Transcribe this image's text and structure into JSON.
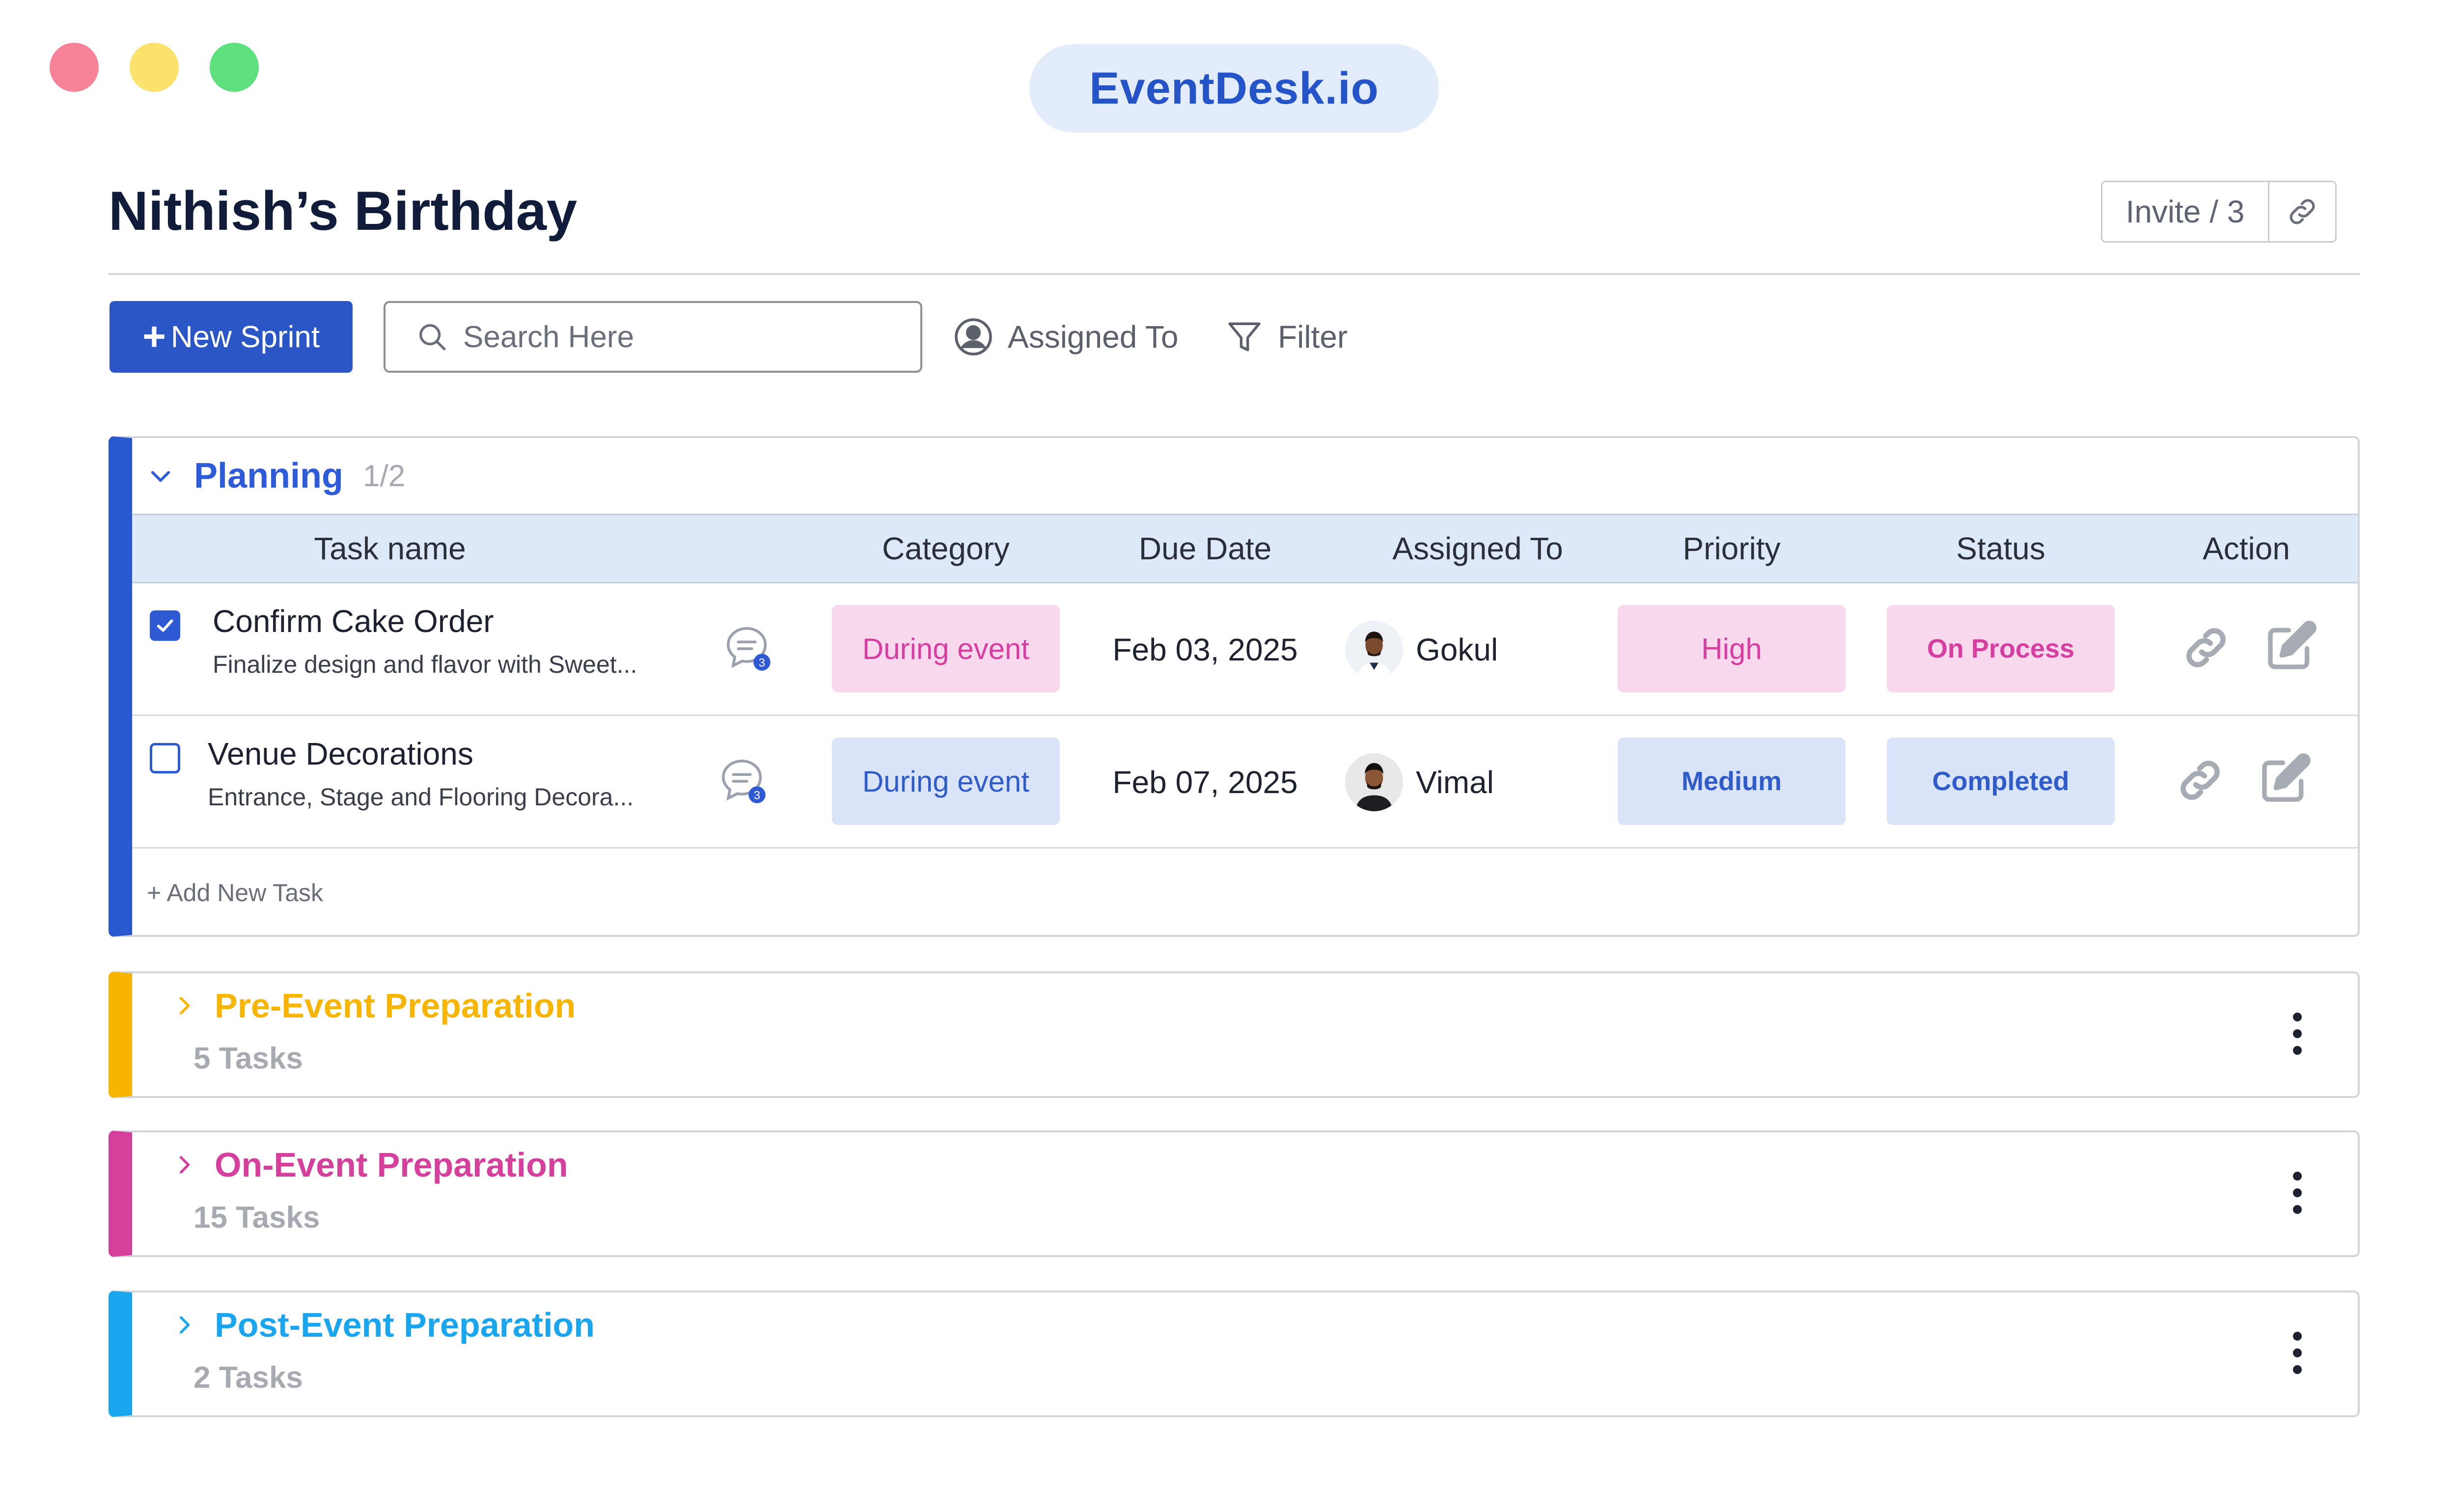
{
  "window": {
    "controls": [
      "close",
      "minimize",
      "maximize"
    ]
  },
  "brand": {
    "label": "EventDesk.io"
  },
  "page": {
    "title": "Nithish’s Birthday"
  },
  "invite": {
    "label": "Invite / 3",
    "link_icon": "link-icon"
  },
  "toolbar": {
    "new_sprint_label": "New Sprint",
    "search_placeholder": "Search Here",
    "assigned_label": "Assigned To",
    "filter_label": "Filter"
  },
  "planning": {
    "name": "Planning",
    "count": "1/2",
    "columns": {
      "task": "Task name",
      "category": "Category",
      "due": "Due Date",
      "assigned": "Assigned To",
      "priority": "Priority",
      "status": "Status",
      "action": "Action"
    },
    "tasks": [
      {
        "checked": true,
        "title": "Confirm Cake Order",
        "description": "Finalize design and flavor with Sweet...",
        "comments": "3",
        "category": "During event",
        "due": "Feb 03, 2025",
        "assignee": "Gokul",
        "priority": "High",
        "status": "On Process"
      },
      {
        "checked": false,
        "title": "Venue Decorations",
        "description": "Entrance, Stage and Flooring Decora...",
        "comments": "3",
        "category": "During event",
        "due": "Feb 07, 2025",
        "assignee": "Vimal",
        "priority": "Medium",
        "status": "Completed"
      }
    ],
    "add_task_label": "+ Add New Task"
  },
  "groups": [
    {
      "name": "Pre-Event Preparation",
      "count": "5 Tasks",
      "color": "#f7b500"
    },
    {
      "name": "On-Event Preparation",
      "count": "15 Tasks",
      "color": "#d4409c"
    },
    {
      "name": "Post-Event Preparation",
      "count": "2 Tasks",
      "color": "#1aa5ef"
    }
  ],
  "colors": {
    "primary": "#2a56c6",
    "planning": "#2958d1",
    "pink_pill_bg": "#f7d8ec",
    "pink_pill_text": "#d63e9f",
    "blue_pill_bg": "#d9e4f9",
    "blue_pill_text": "#2f5cc9"
  }
}
